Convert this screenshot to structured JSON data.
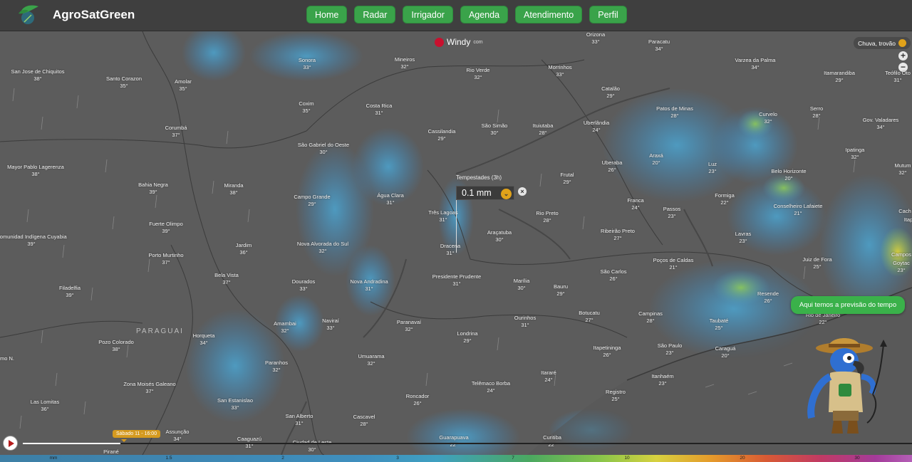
{
  "app": {
    "name": "AgroSatGreen"
  },
  "nav": {
    "home": "Home",
    "radar": "Radar",
    "irrigador": "Irrigador",
    "agenda": "Agenda",
    "atendimento": "Atendimento",
    "perfil": "Perfil"
  },
  "map": {
    "provider": "Windy",
    "provider_suffix": "com",
    "layer": "Chuva, trovão",
    "zoom_in": "+",
    "zoom_out": "−",
    "country_label": "PARAGUAI",
    "picker": {
      "label": "Tempestades (3h)",
      "value": "0.1 mm",
      "close": "×"
    },
    "chat": "Aqui temos a previsão do tempo",
    "timeline": {
      "badge": "Sábado 11 - 16:00",
      "progress": 0.11
    },
    "scale": {
      "unit": "mm",
      "ticks": [
        "1.5",
        "2",
        "3",
        "7",
        "10",
        "20",
        "30"
      ]
    },
    "cities": [
      {
        "n": "Orizona",
        "t": "33°"
      },
      {
        "n": "Paracatu",
        "t": "34°"
      },
      {
        "n": "Varzea da Palma",
        "t": "34°"
      },
      {
        "n": "San Jose de Chiquitos",
        "t": "38°"
      },
      {
        "n": "Santo Corazon",
        "t": "35°"
      },
      {
        "n": "Amolar",
        "t": "35°"
      },
      {
        "n": "Sonora",
        "t": "33°"
      },
      {
        "n": "Mineiros",
        "t": "32°"
      },
      {
        "n": "Rio Verde",
        "t": "32°"
      },
      {
        "n": "Morrinhos",
        "t": "33°"
      },
      {
        "n": "Itamarandiba",
        "t": "29°"
      },
      {
        "n": "Teófilo Oto",
        "t": "31°"
      },
      {
        "n": "Catalão",
        "t": "29°"
      },
      {
        "n": "Patos de Minas",
        "t": "28°"
      },
      {
        "n": "Coxim",
        "t": "35°"
      },
      {
        "n": "Costa Rica",
        "t": "31°"
      },
      {
        "n": "Serro",
        "t": "28°"
      },
      {
        "n": "Curvelo",
        "t": "32°"
      },
      {
        "n": "Gov. Valadares",
        "t": "34°"
      },
      {
        "n": "São Simão",
        "t": "30°"
      },
      {
        "n": "Ituiutaba",
        "t": "28°"
      },
      {
        "n": "Uberlândia",
        "t": "24°"
      },
      {
        "n": "Corumbá",
        "t": "37°"
      },
      {
        "n": "Cassilandia",
        "t": "29°"
      },
      {
        "n": "São Gabriel do Oeste",
        "t": "30°"
      },
      {
        "n": "Ipatinga",
        "t": "32°"
      },
      {
        "n": "Araxá",
        "t": "20°"
      },
      {
        "n": "Luz",
        "t": "23°"
      },
      {
        "n": "Mutum",
        "t": "32°"
      },
      {
        "n": "Mayor Pablo Lagerenza",
        "t": "38°"
      },
      {
        "n": "Uberaba",
        "t": "26°"
      },
      {
        "n": "Belo Horizonte",
        "t": "20°"
      },
      {
        "n": "Frutal",
        "t": "29°"
      },
      {
        "n": "Bahia Negra",
        "t": "39°"
      },
      {
        "n": "Miranda",
        "t": "38°"
      },
      {
        "n": "Campo Grande",
        "t": "29°"
      },
      {
        "n": "Água Clara",
        "t": "31°"
      },
      {
        "n": "Formiga",
        "t": "22°"
      },
      {
        "n": "Franca",
        "t": "24°"
      },
      {
        "n": "Conselheiro Lafaiete",
        "t": "21°"
      },
      {
        "n": "Cach",
        "t": ""
      },
      {
        "n": "Itap",
        "t": ""
      },
      {
        "n": "Três Lagoas",
        "t": "31°"
      },
      {
        "n": "Passos",
        "t": "23°"
      },
      {
        "n": "Rio Preto",
        "t": "28°"
      },
      {
        "n": "Fuerte Olimpo",
        "t": "39°"
      },
      {
        "n": "Araçatuba",
        "t": "30°"
      },
      {
        "n": "Ribeirão Preto",
        "t": "27°"
      },
      {
        "n": "Lavras",
        "t": "23°"
      },
      {
        "n": "Comunidad Indígena Cuyabia",
        "t": "39°"
      },
      {
        "n": "Jardim",
        "t": "36°"
      },
      {
        "n": "Nova Alvorada do Sul",
        "t": "32°"
      },
      {
        "n": "Dracena",
        "t": "31°"
      },
      {
        "n": "Campos",
        "t": ""
      },
      {
        "n": "Goytac",
        "t": "23°"
      },
      {
        "n": "Porto Murtinho",
        "t": "37°"
      },
      {
        "n": "Juiz de Fora",
        "t": "25°"
      },
      {
        "n": "Poços de Caldas",
        "t": "21°"
      },
      {
        "n": "São Carlos",
        "t": "26°"
      },
      {
        "n": "Presidente Prudente",
        "t": "31°"
      },
      {
        "n": "Bela Vista",
        "t": "37°"
      },
      {
        "n": "Dourados",
        "t": "33°"
      },
      {
        "n": "Nova Andradina",
        "t": "31°"
      },
      {
        "n": "Marília",
        "t": "30°"
      },
      {
        "n": "Bauru",
        "t": "29°"
      },
      {
        "n": "Filadelfia",
        "t": "39°"
      },
      {
        "n": "Resende",
        "t": "26°"
      },
      {
        "n": "Campinas",
        "t": "28°"
      },
      {
        "n": "Botucatu",
        "t": "27°"
      },
      {
        "n": "Amambai",
        "t": "32°"
      },
      {
        "n": "Naviraí",
        "t": "33°"
      },
      {
        "n": "Paranavaí",
        "t": "32°"
      },
      {
        "n": "Ourinhos",
        "t": "31°"
      },
      {
        "n": "Rio de Janeiro",
        "t": "22°"
      },
      {
        "n": "Horqueta",
        "t": "34°"
      },
      {
        "n": "Londrina",
        "t": "29°"
      },
      {
        "n": "Taubaté",
        "t": "25°"
      },
      {
        "n": "Pozo Colorado",
        "t": "38°"
      },
      {
        "n": "Itapetininga",
        "t": "26°"
      },
      {
        "n": "São Paulo",
        "t": "23°"
      },
      {
        "n": "Caraguá",
        "t": "20°"
      },
      {
        "n": "Umuarama",
        "t": "32°"
      },
      {
        "n": "Paranhos",
        "t": "32°"
      },
      {
        "n": "mo N.",
        "t": ""
      },
      {
        "n": "Itararé",
        "t": "24°"
      },
      {
        "n": "Zona Moisés Galeano",
        "t": "37°"
      },
      {
        "n": "Telêmaco Borba",
        "t": "24°"
      },
      {
        "n": "Itanhaém",
        "t": "23°"
      },
      {
        "n": "San Estanislao",
        "t": "33°"
      },
      {
        "n": "Roncador",
        "t": "26°"
      },
      {
        "n": "Registro",
        "t": "25°"
      },
      {
        "n": "Las Lomitas",
        "t": "36°"
      },
      {
        "n": "San Alberto",
        "t": "31°"
      },
      {
        "n": "Cascavel",
        "t": "28°"
      },
      {
        "n": "Assunção",
        "t": "34°"
      },
      {
        "n": "Guarapuava",
        "t": "22°"
      },
      {
        "n": "Curitiba",
        "t": "22°"
      },
      {
        "n": "Caaguazú",
        "t": "31°"
      },
      {
        "n": "Ciudad de Leste",
        "t": "30°"
      },
      {
        "n": "Pirané",
        "t": ""
      }
    ]
  }
}
